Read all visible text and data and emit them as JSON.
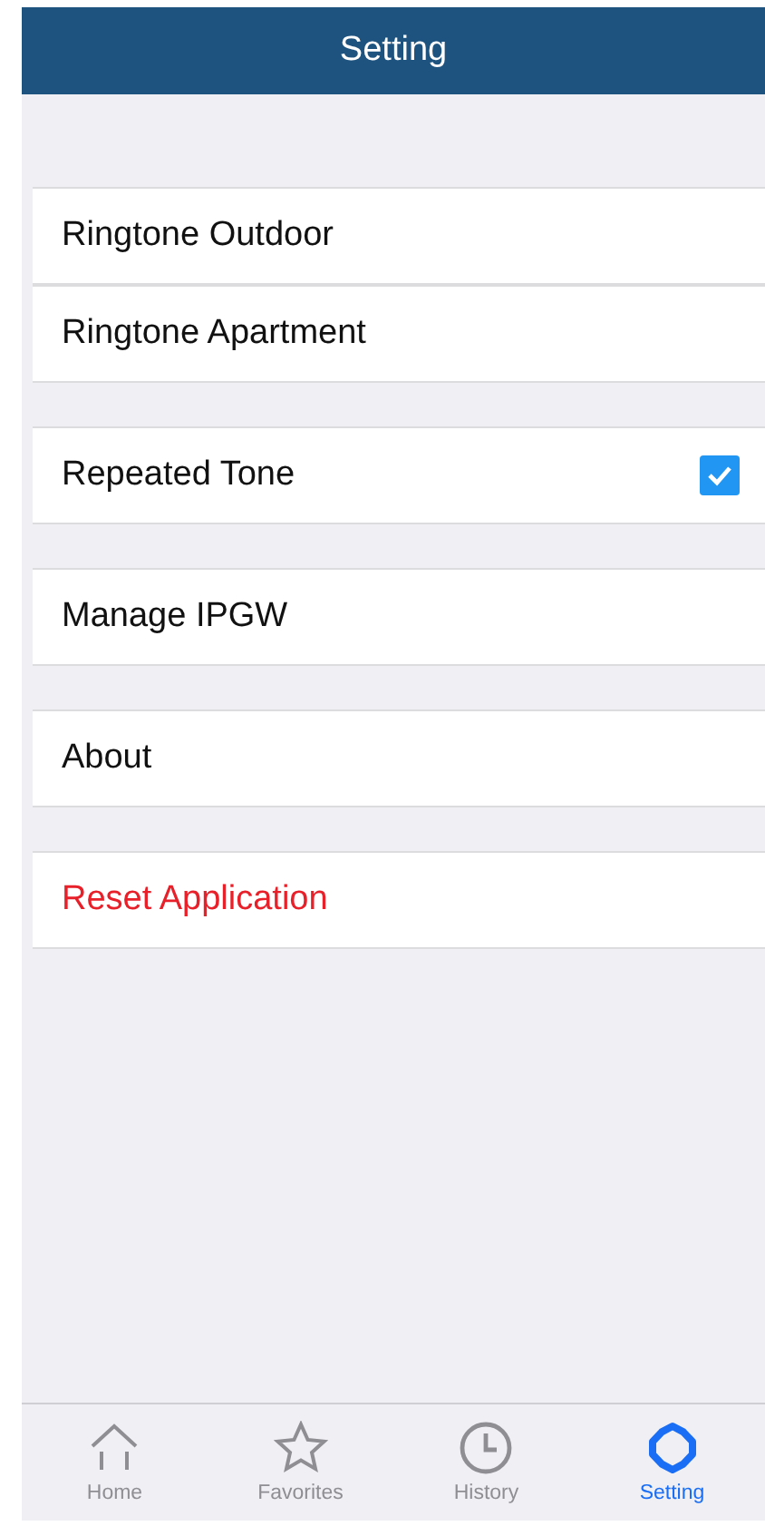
{
  "header": {
    "title": "Setting"
  },
  "groups": [
    {
      "items": [
        {
          "kind": "link",
          "label": "Ringtone Outdoor"
        },
        {
          "kind": "link",
          "label": "Ringtone Apartment"
        }
      ]
    },
    {
      "items": [
        {
          "kind": "checkbox",
          "label": "Repeated Tone",
          "checked": true
        }
      ]
    },
    {
      "items": [
        {
          "kind": "link",
          "label": "Manage IPGW"
        }
      ]
    },
    {
      "items": [
        {
          "kind": "link",
          "label": "About"
        }
      ]
    },
    {
      "items": [
        {
          "kind": "danger",
          "label": "Reset Application"
        }
      ]
    }
  ],
  "tab_bar": [
    {
      "kind": "home",
      "label": "Home",
      "selected": false
    },
    {
      "kind": "favorites",
      "label": "Favorites",
      "selected": false
    },
    {
      "kind": "history",
      "label": "History",
      "selected": false
    },
    {
      "kind": "settings",
      "label": "Setting",
      "selected": true
    }
  ]
}
